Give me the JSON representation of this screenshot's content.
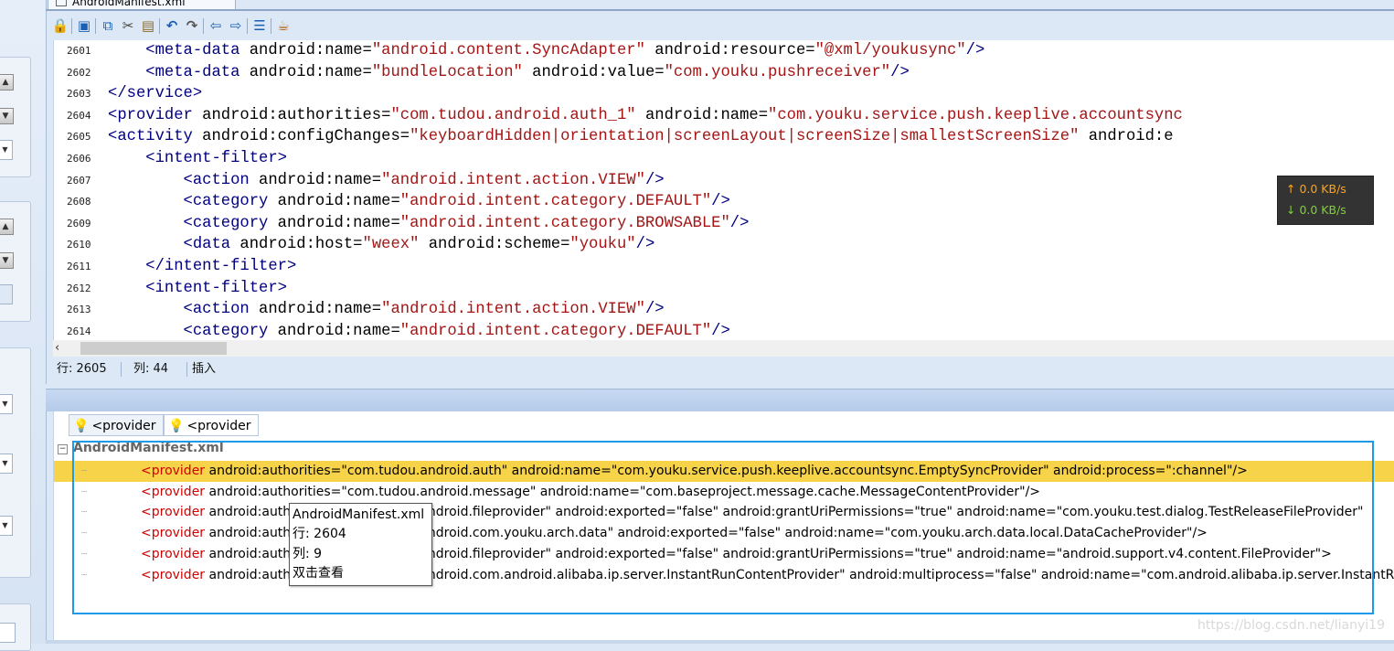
{
  "tab": {
    "title": "AndroidManifest.xml"
  },
  "toolbar": {
    "icons": [
      "lock-icon",
      "save-icon",
      "copy-icon",
      "cut-icon",
      "paste-icon",
      "undo-icon",
      "redo-icon",
      "back-icon",
      "forward-icon",
      "format-icon",
      "java-icon"
    ]
  },
  "editor": {
    "lines": [
      {
        "n": "2601",
        "indent": "    ",
        "parts": [
          [
            "tag",
            "<meta-data "
          ],
          [
            "attr",
            "android:name="
          ],
          [
            "val",
            "\"android.content.SyncAdapter\""
          ],
          [
            "attr",
            " android:resource="
          ],
          [
            "val",
            "\"@xml/youkusync\""
          ],
          [
            "tag",
            "/>"
          ]
        ]
      },
      {
        "n": "2602",
        "indent": "    ",
        "parts": [
          [
            "tag",
            "<meta-data "
          ],
          [
            "attr",
            "android:name="
          ],
          [
            "val",
            "\"bundleLocation\""
          ],
          [
            "attr",
            " android:value="
          ],
          [
            "val",
            "\"com.youku.pushreceiver\""
          ],
          [
            "tag",
            "/>"
          ]
        ]
      },
      {
        "n": "2603",
        "indent": "",
        "parts": [
          [
            "tag",
            "</service>"
          ]
        ]
      },
      {
        "n": "2604",
        "indent": "",
        "parts": [
          [
            "tag",
            "<provider "
          ],
          [
            "attr",
            "android:authorities="
          ],
          [
            "val",
            "\"com.tudou.android.auth_1\""
          ],
          [
            "attr",
            " android:name="
          ],
          [
            "val",
            "\"com.youku.service.push.keeplive.accountsync"
          ]
        ]
      },
      {
        "n": "2605",
        "indent": "",
        "parts": [
          [
            "tag",
            "<activity "
          ],
          [
            "attr",
            "android:configChanges="
          ],
          [
            "val",
            "\"keyboardHidden|orientation|screenLayout|screenSize|smallestScreenSize\""
          ],
          [
            "attr",
            " android:e"
          ]
        ]
      },
      {
        "n": "2606",
        "indent": "    ",
        "parts": [
          [
            "tag",
            "<intent-filter>"
          ]
        ]
      },
      {
        "n": "2607",
        "indent": "        ",
        "parts": [
          [
            "tag",
            "<action "
          ],
          [
            "attr",
            "android:name="
          ],
          [
            "val",
            "\"android.intent.action.VIEW\""
          ],
          [
            "tag",
            "/>"
          ]
        ]
      },
      {
        "n": "2608",
        "indent": "        ",
        "parts": [
          [
            "tag",
            "<category "
          ],
          [
            "attr",
            "android:name="
          ],
          [
            "val",
            "\"android.intent.category.DEFAULT\""
          ],
          [
            "tag",
            "/>"
          ]
        ]
      },
      {
        "n": "2609",
        "indent": "        ",
        "parts": [
          [
            "tag",
            "<category "
          ],
          [
            "attr",
            "android:name="
          ],
          [
            "val",
            "\"android.intent.category.BROWSABLE\""
          ],
          [
            "tag",
            "/>"
          ]
        ]
      },
      {
        "n": "2610",
        "indent": "        ",
        "parts": [
          [
            "tag",
            "<data "
          ],
          [
            "attr",
            "android:host="
          ],
          [
            "val",
            "\"weex\""
          ],
          [
            "attr",
            " android:scheme="
          ],
          [
            "val",
            "\"youku\""
          ],
          [
            "tag",
            "/>"
          ]
        ]
      },
      {
        "n": "2611",
        "indent": "    ",
        "parts": [
          [
            "tag",
            "</intent-filter>"
          ]
        ]
      },
      {
        "n": "2612",
        "indent": "    ",
        "parts": [
          [
            "tag",
            "<intent-filter>"
          ]
        ]
      },
      {
        "n": "2613",
        "indent": "        ",
        "parts": [
          [
            "tag",
            "<action "
          ],
          [
            "attr",
            "android:name="
          ],
          [
            "val",
            "\"android.intent.action.VIEW\""
          ],
          [
            "tag",
            "/>"
          ]
        ]
      },
      {
        "n": "2614",
        "indent": "        ",
        "parts": [
          [
            "tag",
            "<category "
          ],
          [
            "attr",
            "android:name="
          ],
          [
            "val",
            "\"android.intent.category.DEFAULT\""
          ],
          [
            "tag",
            "/>"
          ]
        ]
      }
    ]
  },
  "status": {
    "row": "行: 2605",
    "col": "列: 44",
    "mode": "插入"
  },
  "results": {
    "tabs": [
      "<provider",
      "<provider"
    ],
    "root": "AndroidManifest.xml",
    "rows": [
      {
        "tag": "<provider",
        "rest": " android:authorities=\"com.tudou.android.auth\" android:name=\"com.youku.service.push.keeplive.accountsync.EmptySyncProvider\" android:process=\":channel\"/>",
        "highlighted": true
      },
      {
        "tag": "<provider",
        "rest": " android:authorities=\"com.tudou.android.message\" android:name=\"com.baseproject.message.cache.MessageContentProvider\"/>",
        "highlighted": false
      },
      {
        "tag": "<provider",
        "rest": " android:authorities=\"com.tudou.android.fileprovider\" android:exported=\"false\" android:grantUriPermissions=\"true\" android:name=\"com.youku.test.dialog.TestReleaseFileProvider\"",
        "highlighted": false
      },
      {
        "tag": "<provider",
        "rest": " android:authorities=\"com.tudou.android.com.youku.arch.data\" android:exported=\"false\" android:name=\"com.youku.arch.data.local.DataCacheProvider\"/>",
        "highlighted": false
      },
      {
        "tag": "<provider",
        "rest": " android:authorities=\"com.tudou.android.fileprovider\" android:exported=\"false\" android:grantUriPermissions=\"true\" android:name=\"android.support.v4.content.FileProvider\">",
        "highlighted": false
      },
      {
        "tag": "<provider",
        "rest": " android:authorities=\"com.tudou.android.com.android.alibaba.ip.server.InstantRunContentProvider\" android:multiprocess=\"false\" android:name=\"com.android.alibaba.ip.server.InstantRunContentProvider\"",
        "highlighted": false
      }
    ]
  },
  "tooltip": {
    "file": "AndroidManifest.xml",
    "row": "行: 2604",
    "col": "列: 9",
    "hint": "双击查看"
  },
  "netspeed": {
    "up": "↑ 0.0 KB/s",
    "down": "↓ 0.0 KB/s"
  },
  "watermark": "https://blog.csdn.net/lianyi19",
  "colors": {
    "tag": "#000080",
    "value": "#a31515",
    "result_tag": "#d00000",
    "highlight": "#f7d34a",
    "selection_border": "#1e9be8"
  }
}
